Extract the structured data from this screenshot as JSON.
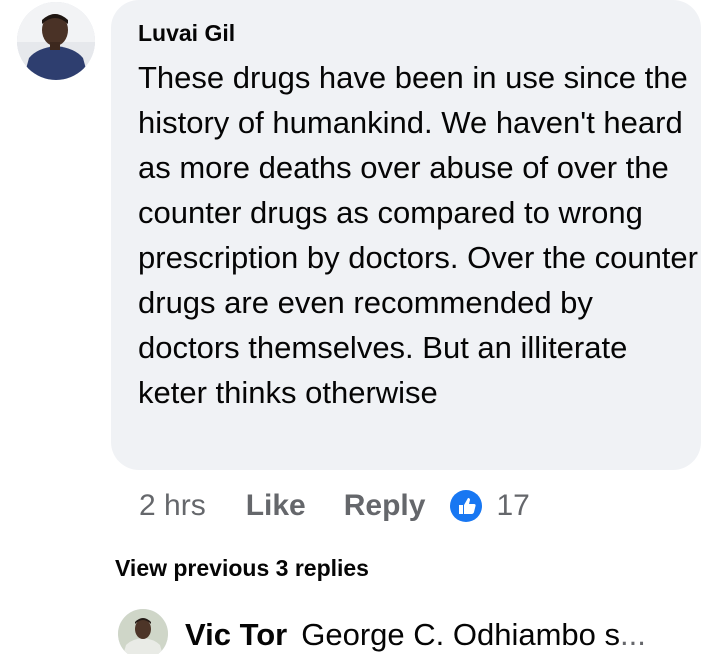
{
  "comment": {
    "author": "Luvai Gil",
    "text": "These drugs have been in use since the history of humankind. We haven't heard as more deaths over abuse of over the counter drugs as compared to wrong prescription by doctors. Over the counter drugs are even recommended by doctors themselves. But an illiterate keter thinks otherwise",
    "time": "2 hrs",
    "like_label": "Like",
    "reply_label": "Reply",
    "reaction_count": "17",
    "reaction_icon": "thumbs-up-icon"
  },
  "replies": {
    "view_previous_label": "View previous 3 replies",
    "preview": {
      "author": "Vic Tor",
      "text": "George C. Odhiambo s",
      "ellipsis": "..."
    }
  },
  "colors": {
    "bubble_bg": "#f0f2f5",
    "meta_text": "#65676b",
    "like_blue": "#1877f2"
  }
}
